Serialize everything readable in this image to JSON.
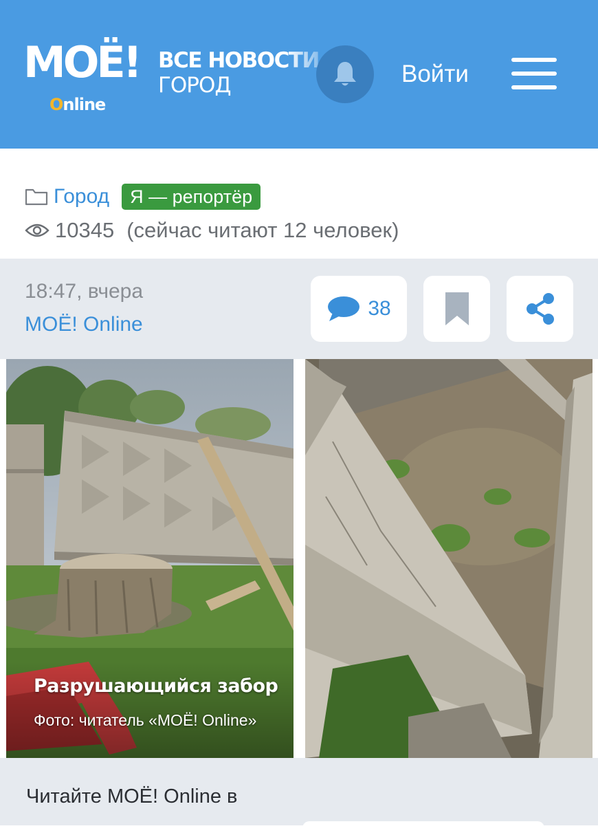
{
  "header": {
    "logo": {
      "main": "МОЁ!",
      "sub_o": "O",
      "sub_rest": "nline"
    },
    "tagline_line1": "ВСЕ НОВОСТИ",
    "tagline_line2": "ГОРОД",
    "notifications_icon": "bell-icon",
    "login_label": "Войти",
    "menu_icon": "hamburger-icon",
    "brand_color": "#4a9be2"
  },
  "meta": {
    "category": "Город",
    "category_icon": "folder-icon",
    "badge": "Я — репортёр",
    "badge_color": "#3a9a3f",
    "views_icon": "eye-icon",
    "views": "10345",
    "reading_now": "(сейчас читают 12 человек)"
  },
  "infobar": {
    "time": "18:47, вчера",
    "source": "МОЁ! Online",
    "comments_icon": "comment-icon",
    "comments_count": "38",
    "bookmark_icon": "bookmark-icon",
    "share_icon": "share-icon",
    "accent_color": "#3a8fd9"
  },
  "gallery": {
    "caption_title": "Разрушающийся забор",
    "caption_credit": "Фото: читатель «МОЁ! Online»"
  },
  "footer": {
    "read_us": "Читайте МОЁ! Online в"
  }
}
